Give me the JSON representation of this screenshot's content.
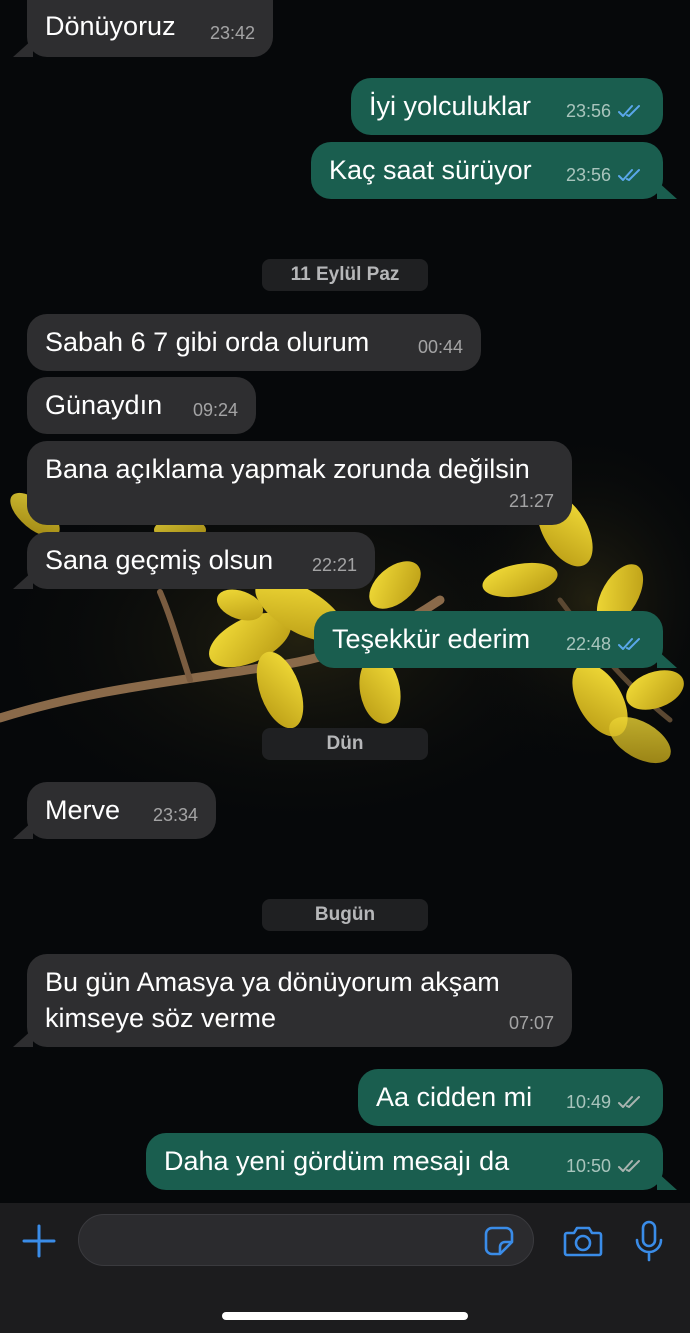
{
  "messages": [
    {
      "text": "Dönüyoruz",
      "time": "23:42",
      "dir": "in"
    },
    {
      "text": "İyi yolculuklar",
      "time": "23:56",
      "dir": "out",
      "status": "read"
    },
    {
      "text": "Kaç saat sürüyor",
      "time": "23:56",
      "dir": "out",
      "status": "read"
    },
    {
      "text": "Sabah 6 7 gibi orda olurum",
      "time": "00:44",
      "dir": "in"
    },
    {
      "text": "Günaydın",
      "time": "09:24",
      "dir": "in"
    },
    {
      "text": "Bana açıklama yapmak zorunda değilsin",
      "time": "21:27",
      "dir": "in"
    },
    {
      "text": "Sana geçmiş olsun",
      "time": "22:21",
      "dir": "in"
    },
    {
      "text": "Teşekkür ederim",
      "time": "22:48",
      "dir": "out",
      "status": "read"
    },
    {
      "text": "Merve",
      "time": "23:34",
      "dir": "in"
    },
    {
      "line1": "Bu gün Amasya ya dönüyorum akşam",
      "line2": "kimseye söz verme",
      "time": "07:07",
      "dir": "in"
    },
    {
      "text": "Aa cidden mi",
      "time": "10:49",
      "dir": "out",
      "status": "delivered"
    },
    {
      "text": "Daha yeni gördüm mesajı da",
      "time": "10:50",
      "dir": "out",
      "status": "delivered"
    }
  ],
  "dates": [
    "11 Eylül Paz",
    "Dün",
    "Bugün"
  ],
  "input": {
    "placeholder": ""
  },
  "icons": {
    "add": "plus-icon",
    "sticker": "sticker-icon",
    "camera": "camera-icon",
    "mic": "microphone-icon",
    "read_ticks": "double-check-icon"
  },
  "colors": {
    "incoming_bubble": "#2e2e30",
    "outgoing_bubble": "#1a5e4f",
    "read_ticks": "#5aa7ea",
    "delivered_ticks": "#a9b4b0",
    "accent": "#3a8ce8"
  }
}
